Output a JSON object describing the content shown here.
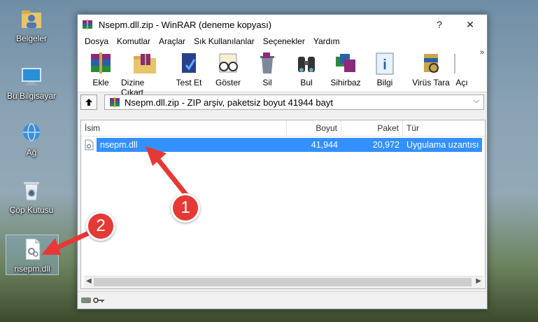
{
  "desktop": {
    "icons": [
      {
        "label": "Belgeler"
      },
      {
        "label": "Bu Bilgisayar"
      },
      {
        "label": "Ağ"
      },
      {
        "label": "Çöp Kutusu"
      },
      {
        "label": "nsepm.dll"
      }
    ]
  },
  "window": {
    "title": "Nsepm.dll.zip - WinRAR (deneme kopyası)",
    "help": "?",
    "close": "✕",
    "menu": [
      "Dosya",
      "Komutlar",
      "Araçlar",
      "Sık Kullanılanlar",
      "Seçenekler",
      "Yardım"
    ],
    "toolbar": [
      "Ekle",
      "Dizine Çıkart",
      "Test Et",
      "Göster",
      "Sil",
      "Bul",
      "Sihirbaz",
      "Bilgi",
      "Virüs Tara",
      "Açı"
    ],
    "toolbar_more": "»",
    "address": "Nsepm.dll.zip - ZIP arşiv, paketsiz boyut 41944 bayt",
    "columns": {
      "name": "İsim",
      "size": "Boyut",
      "packed": "Paket",
      "type": "Tür"
    },
    "files": [
      {
        "name": "nsepm.dll",
        "size": "41,944",
        "packed": "20,972",
        "type": "Uygulama uzantısı"
      }
    ]
  },
  "annotations": {
    "step1": "1",
    "step2": "2"
  },
  "colors": {
    "selection": "#3390ff",
    "badge": "#e53935"
  }
}
